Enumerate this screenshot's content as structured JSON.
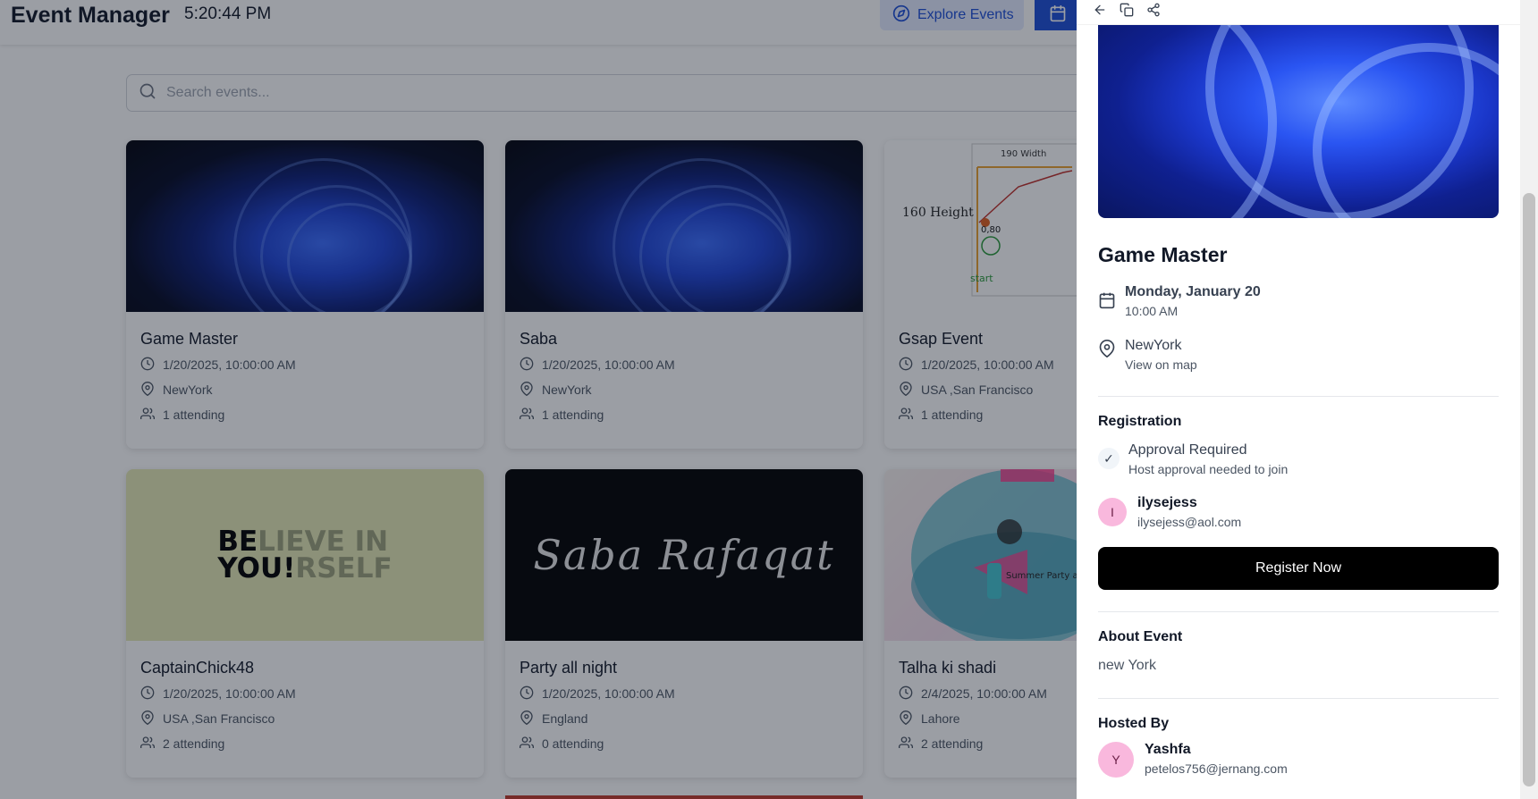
{
  "header": {
    "brand": "Event Manager",
    "time": "5:20:44 PM",
    "explore_label": "Explore Events"
  },
  "search": {
    "placeholder": "Search events..."
  },
  "events": [
    {
      "title": "Game Master",
      "date": "1/20/2025, 10:00:00 AM",
      "location": "NewYork",
      "attending": "1 attending"
    },
    {
      "title": "Saba",
      "date": "1/20/2025, 10:00:00 AM",
      "location": "NewYork",
      "attending": "1 attending"
    },
    {
      "title": "Gsap Event",
      "date": "1/20/2025, 10:00:00 AM",
      "location": "USA ,San Francisco",
      "attending": "1 attending"
    },
    {
      "title": "CaptainChick48",
      "date": "1/20/2025, 10:00:00 AM",
      "location": "USA ,San Francisco",
      "attending": "2 attending"
    },
    {
      "title": "Party all night",
      "date": "1/20/2025, 10:00:00 AM",
      "location": "England",
      "attending": "0 attending"
    },
    {
      "title": "Talha ki shadi",
      "date": "2/4/2025, 10:00:00 AM",
      "location": "Lahore",
      "attending": "2 attending"
    }
  ],
  "card_images": {
    "chart_text_1": "190 Width",
    "chart_text_2": "160 Height",
    "chart_text_3": "0,80",
    "chart_text_4": "start",
    "believe_dark_1": "BE",
    "believe_fade_1": "LIEVE IN",
    "believe_dark_2": "YOU!",
    "believe_fade_2": "RSELF",
    "script_text": "Saba Rafaqat",
    "party_text": "Summer Party at O"
  },
  "panel": {
    "title": "Game Master",
    "date_main": "Monday, January 20",
    "date_time": "10:00 AM",
    "location": "NewYork",
    "map_link": "View on map",
    "registration_heading": "Registration",
    "approval_title": "Approval Required",
    "approval_sub": "Host approval needed to join",
    "user_initial": "I",
    "user_name": "ilysejess",
    "user_email": "ilysejess@aol.com",
    "register_label": "Register Now",
    "about_heading": "About Event",
    "about_text": "new York",
    "hosted_heading": "Hosted By",
    "host_initial": "Y",
    "host_name": "Yashfa",
    "host_email": "petelos756@jernang.com"
  },
  "colors": {
    "accent": "#1d4ed8",
    "accent_light": "#e4eaff",
    "avatar_pink": "#f9b8dd",
    "overlay": "#111827"
  }
}
